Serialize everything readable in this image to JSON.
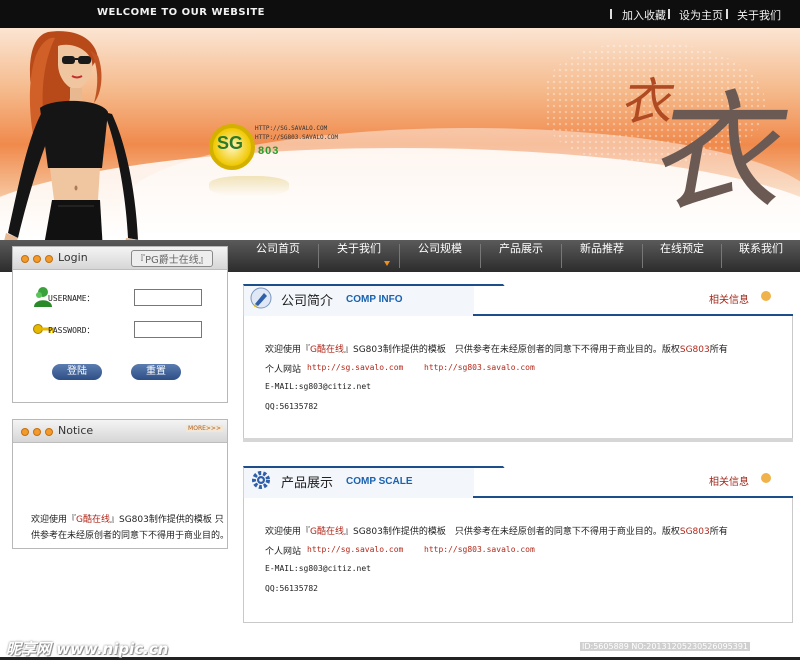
{
  "topbar": {
    "welcome": "WELCOME TO OUR WEBSITE",
    "links": [
      "加入收藏",
      "设为主页",
      "关于我们"
    ]
  },
  "banner": {
    "url_line1": "HTTP://SG.SAVALO.COM",
    "url_line2": "HTTP://SG803.SAVALO.COM",
    "logo_text": "SG",
    "logo_num": "803",
    "big_char": "衣",
    "small_char": "衣"
  },
  "nav": {
    "items": [
      "公司首页",
      "关于我们",
      "公司规模",
      "产品展示",
      "新品推荐",
      "在线预定",
      "联系我们"
    ]
  },
  "login": {
    "title": "Login",
    "badge": "『PG爵士在线』",
    "username_label": "USERNAME：",
    "password_label": "PASSWORD：",
    "login_button": "登陆",
    "reset_button": "重置"
  },
  "notice": {
    "title": "Notice",
    "more": "MORE>>>",
    "text_prefix": "欢迎使用『",
    "text_brand": "G酷在线",
    "text_suffix": "』SG803制作提供的模板 只供参考在未经原创者的同意下不得用于商业目的。"
  },
  "panels": [
    {
      "title_zh": "公司简介",
      "title_en": "COMP INFO",
      "related": "相关信息",
      "line1_prefix": "欢迎使用『",
      "line1_brand": "G酷在线",
      "line1_mid": "』SG803制作提供的模板　只供参考在未经原创者的同意下不得用于商业目的。版权",
      "line1_code": "SG803",
      "line1_end": "所有",
      "line2_label": "个人网站",
      "url1": "http://sg.savalo.com",
      "url2": "http://sg803.savalo.com",
      "email": "E-MAIL:sg803@citiz.net",
      "qq": "QQ:56135782"
    },
    {
      "title_zh": "产品展示",
      "title_en": "COMP SCALE",
      "related": "相关信息",
      "line1_prefix": "欢迎使用『",
      "line1_brand": "G酷在线",
      "line1_mid": "』SG803制作提供的模板　只供参考在未经原创者的同意下不得用于商业目的。版权",
      "line1_code": "SG803",
      "line1_end": "所有",
      "line2_label": "个人网站",
      "url1": "http://sg.savalo.com",
      "url2": "http://sg803.savalo.com",
      "email": "E-MAIL:sg803@citiz.net",
      "qq": "QQ:56135782"
    }
  ],
  "watermark": {
    "left": "昵享网 www.nipic.cn",
    "right": "ID:5605889 NO:20131205230526095391"
  },
  "colors": {
    "nav_bg": "#3a3a3a",
    "accent_blue": "#1d4e8c",
    "brand_red": "#b0281a",
    "banner_orange": "#f08a4c"
  }
}
